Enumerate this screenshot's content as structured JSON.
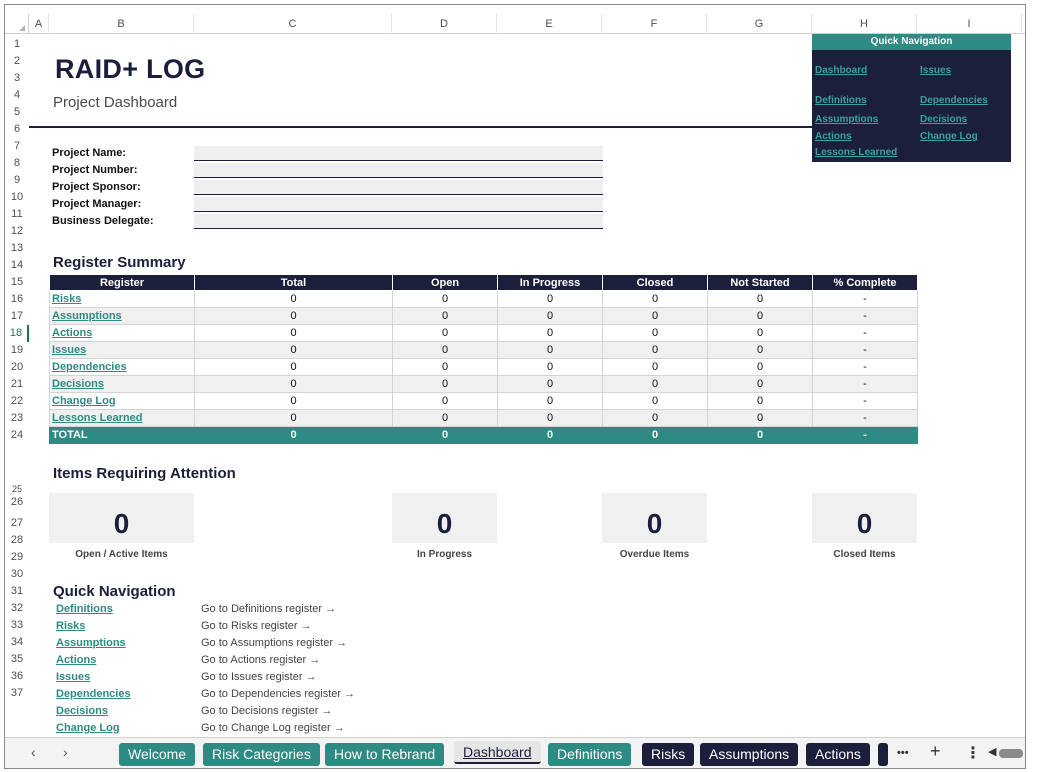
{
  "columns": [
    "A",
    "B",
    "C",
    "D",
    "E",
    "F",
    "G",
    "H",
    "I"
  ],
  "rows": [
    "1",
    "2",
    "3",
    "4",
    "5",
    "6",
    "7",
    "8",
    "9",
    "10",
    "11",
    "12",
    "13",
    "14",
    "15",
    "16",
    "17",
    "18",
    "19",
    "20",
    "21",
    "22",
    "23",
    "24",
    "25",
    "26",
    "27",
    "28",
    "29",
    "30",
    "31",
    "32",
    "33",
    "34",
    "35",
    "36",
    "37"
  ],
  "header": {
    "title": "RAID+ LOG",
    "subtitle": "Project Dashboard"
  },
  "quick_nav_box": {
    "title": "Quick Navigation",
    "links": {
      "dashboard": "Dashboard",
      "issues": "Issues",
      "definitions": "Definitions",
      "dependencies": "Dependencies",
      "assumptions": "Assumptions",
      "decisions": "Decisions",
      "actions": "Actions",
      "change_log": "Change Log",
      "lessons_learned": "Lessons Learned"
    }
  },
  "project_fields": [
    "Project Name:",
    "Project Number:",
    "Project Sponsor:",
    "Project Manager:",
    "Business Delegate:"
  ],
  "register_summary": {
    "title": "Register Summary",
    "columns": [
      "Register",
      "Total",
      "Open",
      "In Progress",
      "Closed",
      "Not Started",
      "% Complete"
    ],
    "rows": [
      {
        "name": "Risks",
        "total": "0",
        "open": "0",
        "in_progress": "0",
        "closed": "0",
        "not_started": "0",
        "pct": "-"
      },
      {
        "name": "Assumptions",
        "total": "0",
        "open": "0",
        "in_progress": "0",
        "closed": "0",
        "not_started": "0",
        "pct": "-"
      },
      {
        "name": "Actions",
        "total": "0",
        "open": "0",
        "in_progress": "0",
        "closed": "0",
        "not_started": "0",
        "pct": "-"
      },
      {
        "name": "Issues",
        "total": "0",
        "open": "0",
        "in_progress": "0",
        "closed": "0",
        "not_started": "0",
        "pct": "-"
      },
      {
        "name": "Dependencies",
        "total": "0",
        "open": "0",
        "in_progress": "0",
        "closed": "0",
        "not_started": "0",
        "pct": "-"
      },
      {
        "name": "Decisions",
        "total": "0",
        "open": "0",
        "in_progress": "0",
        "closed": "0",
        "not_started": "0",
        "pct": "-"
      },
      {
        "name": "Change Log",
        "total": "0",
        "open": "0",
        "in_progress": "0",
        "closed": "0",
        "not_started": "0",
        "pct": "-"
      },
      {
        "name": "Lessons Learned",
        "total": "0",
        "open": "0",
        "in_progress": "0",
        "closed": "0",
        "not_started": "0",
        "pct": "-"
      }
    ],
    "total": {
      "name": "TOTAL",
      "total": "0",
      "open": "0",
      "in_progress": "0",
      "closed": "0",
      "not_started": "0",
      "pct": "-"
    }
  },
  "attention": {
    "title": "Items Requiring Attention",
    "cards": [
      {
        "value": "0",
        "label": "Open / Active Items"
      },
      {
        "value": "0",
        "label": "In Progress"
      },
      {
        "value": "0",
        "label": "Overdue Items"
      },
      {
        "value": "0",
        "label": "Closed Items"
      }
    ]
  },
  "quick_navigation": {
    "title": "Quick Navigation",
    "items": [
      {
        "link": "Definitions",
        "desc": "Go to Definitions register →"
      },
      {
        "link": "Risks",
        "desc": "Go to Risks register →"
      },
      {
        "link": "Assumptions",
        "desc": "Go to Assumptions register →"
      },
      {
        "link": "Actions",
        "desc": "Go to Actions register →"
      },
      {
        "link": "Issues",
        "desc": "Go to Issues register →"
      },
      {
        "link": "Dependencies",
        "desc": "Go to Dependencies register →"
      },
      {
        "link": "Decisions",
        "desc": "Go to Decisions register →"
      },
      {
        "link": "Change Log",
        "desc": "Go to Change Log register →"
      }
    ]
  },
  "tabs": [
    {
      "label": "Welcome",
      "style": "teal"
    },
    {
      "label": "Risk Categories",
      "style": "teal"
    },
    {
      "label": "How to Rebrand",
      "style": "teal"
    },
    {
      "label": "Dashboard",
      "style": "active"
    },
    {
      "label": "Definitions",
      "style": "teal"
    },
    {
      "label": "Risks",
      "style": "navy"
    },
    {
      "label": "Assumptions",
      "style": "navy"
    },
    {
      "label": "Actions",
      "style": "navy"
    }
  ],
  "tab_controls": {
    "prev": "‹",
    "next": "›",
    "more": "•••",
    "add": "+",
    "menu": "⋮",
    "scroll_left": "◀"
  },
  "colors": {
    "navy": "#1b1f3b",
    "teal": "#2e8b83",
    "link": "#38a39a"
  },
  "selected_row": "18"
}
